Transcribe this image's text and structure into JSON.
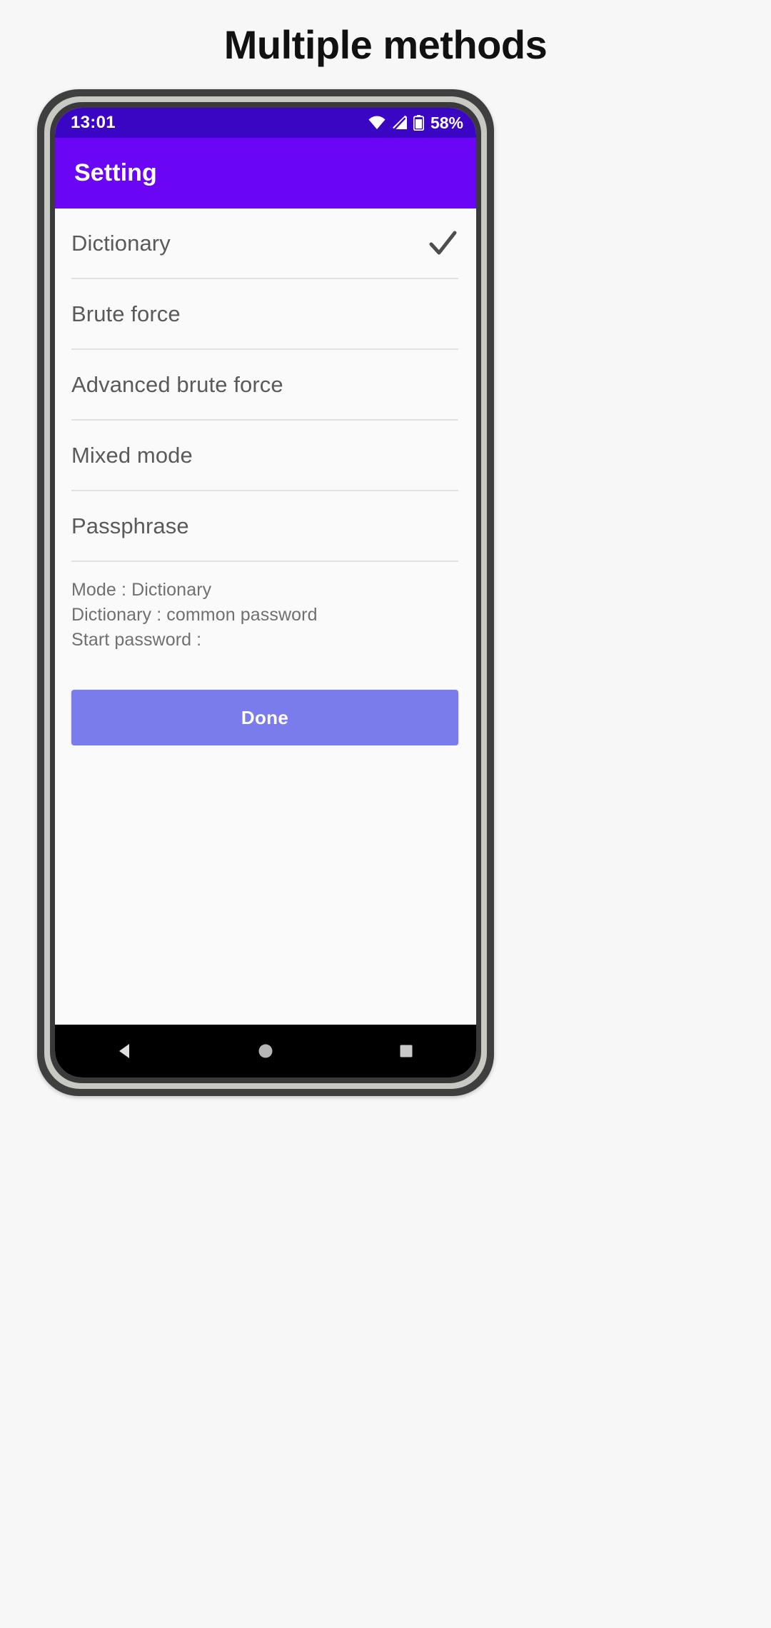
{
  "page": {
    "title": "Multiple methods",
    "background_color": "#f7f7f7"
  },
  "phone": {
    "frame_color": "#3f3f3f",
    "screen_background": "#fafafa"
  },
  "status_bar": {
    "time": "13:01",
    "background_color": "#3a06c4",
    "battery_percent": "58%",
    "icons": [
      "wifi-icon",
      "mobile-signal-icon",
      "battery-icon"
    ]
  },
  "app_bar": {
    "title": "Setting",
    "background_color": "#6a05f5",
    "text_color": "#ffffff"
  },
  "options": [
    {
      "label": "Dictionary",
      "selected": true,
      "check_icon": "check-icon"
    },
    {
      "label": "Brute force",
      "selected": false
    },
    {
      "label": "Advanced brute force",
      "selected": false
    },
    {
      "label": "Mixed mode",
      "selected": false
    },
    {
      "label": "Passphrase",
      "selected": false
    }
  ],
  "summary": {
    "mode_line": "Mode : Dictionary",
    "dictionary_line": "Dictionary : common password",
    "start_password_line": "Start password :"
  },
  "done_button": {
    "label": "Done",
    "color": "#7b7cec",
    "text_color": "#ffffff"
  },
  "nav_bar": {
    "background_color": "#000000",
    "buttons": [
      {
        "name": "back-button",
        "icon": "triangle-left-icon"
      },
      {
        "name": "home-button",
        "icon": "circle-icon"
      },
      {
        "name": "recents-button",
        "icon": "square-icon"
      }
    ]
  }
}
